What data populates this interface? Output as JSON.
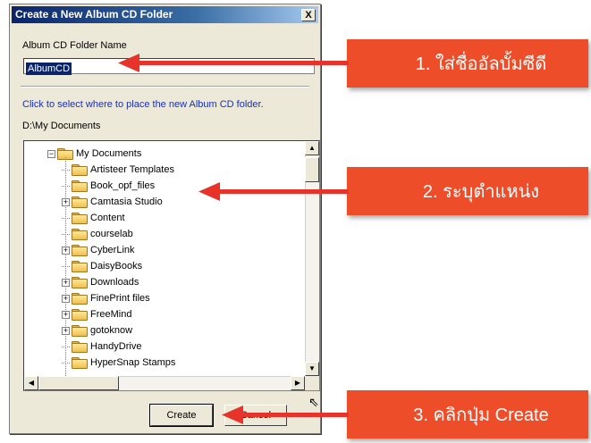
{
  "dialog": {
    "title": "Create a New Album CD Folder",
    "close_label": "X",
    "folder_name_label": "Album CD Folder Name",
    "folder_name_value": "AlbumCD",
    "location_hint": "Click to select where to place the new Album CD folder.",
    "current_path": "D:\\My Documents",
    "tree": {
      "root": "My Documents",
      "items": [
        {
          "label": "Artisteer Templates",
          "expandable": false
        },
        {
          "label": "Book_opf_files",
          "expandable": false
        },
        {
          "label": "Camtasia Studio",
          "expandable": true
        },
        {
          "label": "Content",
          "expandable": false
        },
        {
          "label": "courselab",
          "expandable": false
        },
        {
          "label": "CyberLink",
          "expandable": true
        },
        {
          "label": "DaisyBooks",
          "expandable": false
        },
        {
          "label": "Downloads",
          "expandable": true
        },
        {
          "label": "FinePrint files",
          "expandable": true
        },
        {
          "label": "FreeMind",
          "expandable": true
        },
        {
          "label": "gotoknow",
          "expandable": true
        },
        {
          "label": "HandyDrive",
          "expandable": false
        },
        {
          "label": "HyperSnap Stamps",
          "expandable": false
        }
      ]
    },
    "create_label": "Create",
    "cancel_label": "Cancel"
  },
  "callouts": [
    {
      "text": "1. ใส่ชื่ออัลบั้มซีดี"
    },
    {
      "text": "2. ระบุตำแหน่ง"
    },
    {
      "text": "3. คลิกปุ่ม Create"
    }
  ],
  "colors": {
    "callout_bg": "#ee4d2a",
    "arrow": "#e8332a",
    "titlebar": "#0a246a"
  }
}
